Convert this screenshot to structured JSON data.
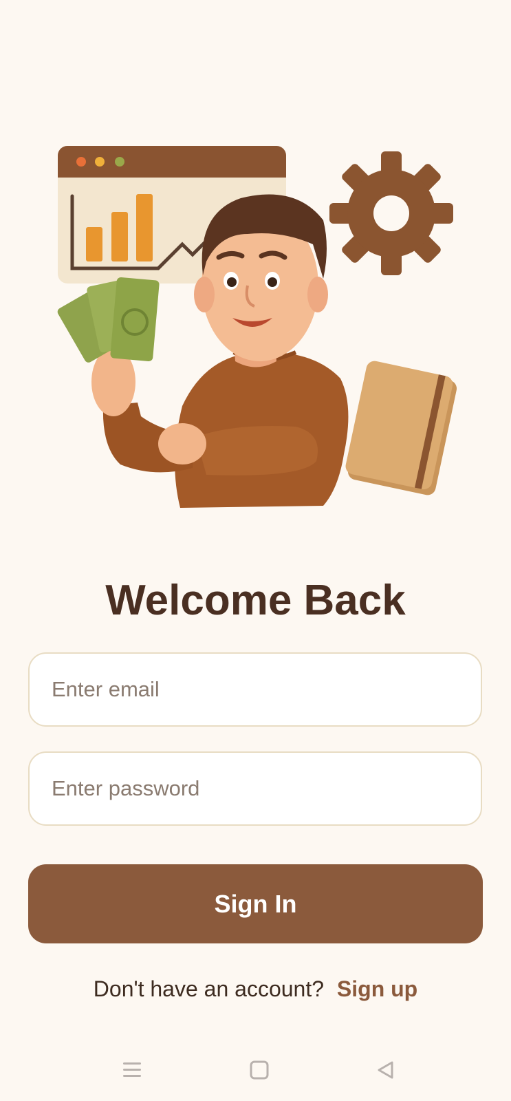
{
  "login": {
    "title": "Welcome Back",
    "email_placeholder": "Enter email",
    "password_placeholder": "Enter password",
    "signin_label": "Sign In",
    "footer_prompt": "Don't have an account?",
    "signup_label": "Sign up"
  },
  "colors": {
    "background": "#fdf8f2",
    "primary": "#8b5a3c",
    "title": "#4a2f22",
    "field_border": "#e8dcc3"
  },
  "navbar": {
    "icons": [
      "menu-icon",
      "home-icon",
      "back-icon"
    ]
  }
}
